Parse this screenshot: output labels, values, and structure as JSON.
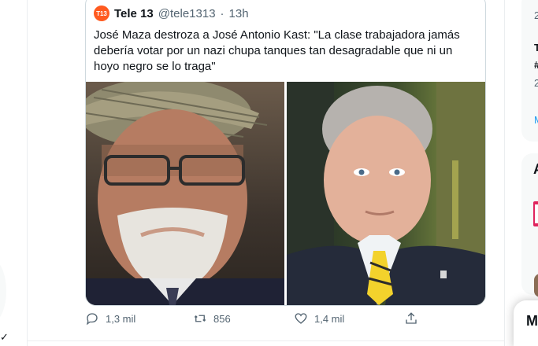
{
  "quoted_tweet": {
    "avatar_text": "T13",
    "name": "Tele 13",
    "handle": "@tele1313",
    "dot": "·",
    "time": "13h",
    "text": "José Maza destroza a José Antonio Kast: \"La clase trabajadora jamás debería votar por un nazi chupa tanques tan desagradable que ni un hoyo negro se lo traga\"",
    "images": [
      {
        "icon": "photo-jose-maza"
      },
      {
        "icon": "photo-jose-antonio-kast"
      }
    ]
  },
  "actions": {
    "reply": "1,3 mil",
    "retweet": "856",
    "like": "1,4 mil"
  },
  "right_sidebar": {
    "partial_1": "2",
    "partial_2": "T",
    "partial_3": "#",
    "partial_4": "2",
    "partial_5": "M",
    "partial_head": "A",
    "drawer_letter": "M"
  },
  "left_rail": {
    "check": "✓"
  }
}
